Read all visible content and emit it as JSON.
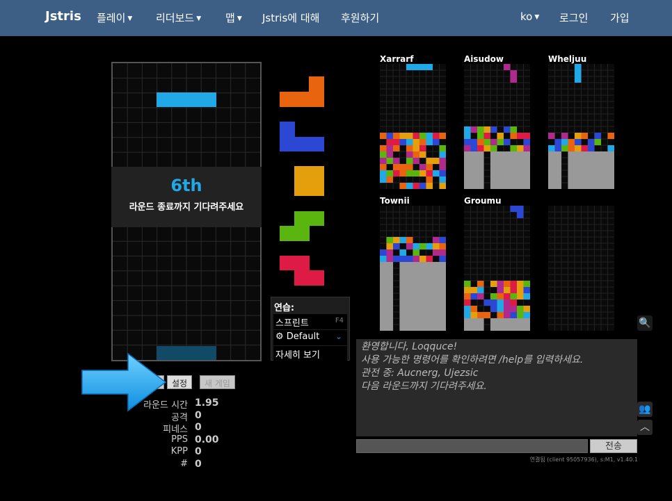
{
  "nav": {
    "brand": "Jstris",
    "items": [
      {
        "label": "플레이",
        "caret": true
      },
      {
        "label": "리더보드",
        "caret": true
      },
      {
        "label": "맵",
        "caret": true
      },
      {
        "label": "Jstris에 대해",
        "caret": false
      },
      {
        "label": "후원하기",
        "caret": false
      }
    ],
    "lang": "ko",
    "login": "로그인",
    "signup": "가입"
  },
  "game": {
    "place": "6th",
    "wait_message": "라운드 종료까지 기다려주세요",
    "queue": [
      "L",
      "J",
      "O",
      "S",
      "Z"
    ]
  },
  "practice": {
    "title": "연습:",
    "sprint_label": "스프린트",
    "sprint_key": "F4",
    "skin_label": "Default",
    "details_label": "자세히 보기"
  },
  "buttons": {
    "settings": "설정",
    "new_game": "새 게임"
  },
  "stats": [
    {
      "label": "라운드 시간",
      "value": "1.95"
    },
    {
      "label": "공격",
      "value": "0"
    },
    {
      "label": "피네스",
      "value": "0"
    },
    {
      "label": "PPS",
      "value": "0.00"
    },
    {
      "label": "KPP",
      "value": "0"
    },
    {
      "label": "#",
      "value": "0"
    }
  ],
  "opponents": [
    {
      "name": "Xarrarf"
    },
    {
      "name": "Aisudow"
    },
    {
      "name": "Wheljuu"
    },
    {
      "name": "Townii"
    },
    {
      "name": "Groumu"
    },
    {
      "name": ""
    }
  ],
  "chat": {
    "lines": [
      "환영합니다, Loqquce!",
      "사용 가능한 명령어를 확인하려면 /help를 입력하세요.",
      "관전 중: Aucnerg, Ujezsic",
      "다음 라운드까지 기다려주세요."
    ],
    "send_label": "전송",
    "version": "연결됨 (client 95057936), s:M1, v1.40.1"
  },
  "colors": {
    "nav_bg": "#3d5f85",
    "I": "#21a8e6",
    "L": "#e8640f",
    "J": "#2b47d4",
    "O": "#e59e0c",
    "S": "#5ab60f",
    "Z": "#dd1b45",
    "T": "#b0298c",
    "garbage": "#999999"
  }
}
